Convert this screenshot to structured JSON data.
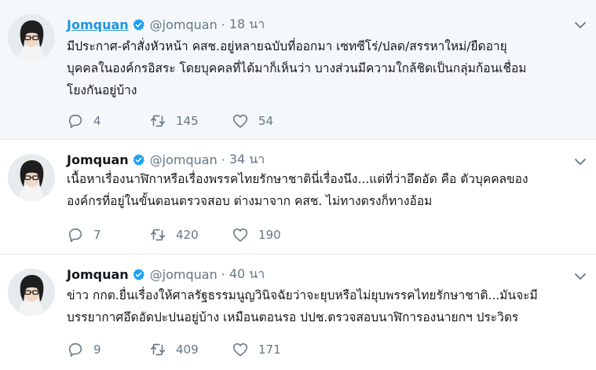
{
  "tweets": [
    {
      "name": "Jomquan",
      "handle": "@jomquan",
      "separator": "·",
      "time": "18 นา",
      "lines": [
        "มีประกาศ-คำสั่งหัวหน้า คสช.อยู่หลายฉบับที่ออกมา เซทซีโร่/ปลด/สรรหาใหม่/ยืดอายุ",
        "บุคคลในองค์กรอิสระ โดยบุคคลที่ได้มาก็เห็นว่า บางส่วนมีความใกล้ชิดเป็นกลุ่มก้อนเชื่อม",
        "โยงกันอยู่บ้าง"
      ],
      "replies": "4",
      "retweets": "145",
      "likes": "54"
    },
    {
      "name": "Jomquan",
      "handle": "@jomquan",
      "separator": "·",
      "time": "34 นา",
      "lines": [
        "เนื้อหาเรื่องนาฬิกาหรือเรื่องพรรคไทยรักษาชาตินี่เรื่องนึง...แต่ที่ว่าอึดอัด คือ ตัวบุคคลของ",
        "องค์กรที่อยู่ในขั้นตอนตรวจสอบ ต่างมาจาก คสช. ไม่ทางตรงก็ทางอ้อม"
      ],
      "replies": "7",
      "retweets": "420",
      "likes": "190"
    },
    {
      "name": "Jomquan",
      "handle": "@jomquan",
      "separator": "·",
      "time": "40 นา",
      "lines": [
        "ข่าว กกต.ยื่นเรื่องให้ศาลรัฐธรรมนูญวินิจฉัยว่าจะยุบหรือไม่ยุบพรรคไทยรักษาชาติ...มันจะมี",
        "บรรยากาศอึดอัดปะปนอยู่บ้าง เหมือนตอนรอ ปปช.ตรวจสอบนาฬิการองนายกฯ ประวิตร"
      ],
      "replies": "9",
      "retweets": "409",
      "likes": "171"
    }
  ],
  "icons": {
    "reply": "reply-icon",
    "retweet": "retweet-icon",
    "like": "like-icon",
    "verified": "verified-badge-icon",
    "caret": "chevron-down-icon"
  },
  "colors": {
    "name_link": "#1b95e0",
    "verified": "#1da1f2",
    "muted": "#657786",
    "text": "#14171a",
    "divider": "#e6ecf0",
    "highlight_bg": "#f5f8fa"
  }
}
